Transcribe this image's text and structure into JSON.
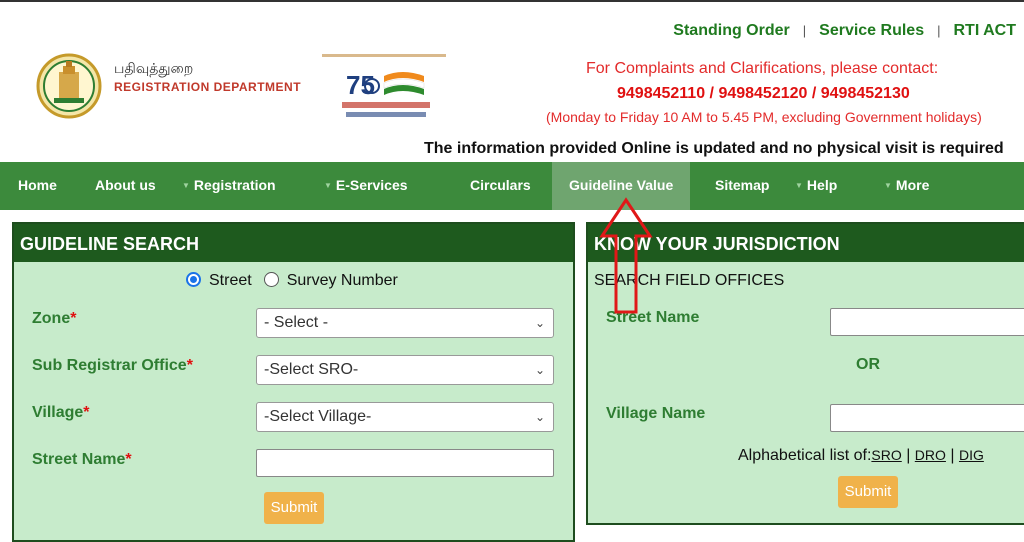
{
  "header": {
    "dept_tamil": "பதிவுத்துறை",
    "dept_english": "REGISTRATION DEPARTMENT",
    "azadi_text": "75",
    "top_links": [
      "Standing Order",
      "Service Rules",
      "RTI ACT"
    ],
    "contact_line1": "For Complaints and Clarifications, please contact:",
    "contact_phones": "9498452110 / 9498452120 / 9498452130",
    "contact_hours": "(Monday to Friday 10 AM to 5.45 PM, excluding Government holidays)",
    "marquee": "The information provided Online is updated and no physical visit is required"
  },
  "nav": {
    "items": [
      {
        "label": "Home"
      },
      {
        "label": "About us"
      },
      {
        "label": "Registration"
      },
      {
        "label": "E-Services"
      },
      {
        "label": "Circulars"
      },
      {
        "label": "Guideline Value"
      },
      {
        "label": "Sitemap"
      },
      {
        "label": "Help"
      },
      {
        "label": "More"
      }
    ]
  },
  "guideline": {
    "title": "GUIDELINE SEARCH",
    "radio_street": "Street",
    "radio_survey": "Survey Number",
    "selected_radio": "Street",
    "zone_label": "Zone",
    "zone_value": "- Select -",
    "sro_label": "Sub Registrar Office",
    "sro_value": "-Select SRO-",
    "village_label": "Village",
    "village_value": "-Select Village-",
    "street_label": "Street Name",
    "street_value": "",
    "required_mark": "*",
    "submit_label": "Submit"
  },
  "jurisdiction": {
    "title": "KNOW YOUR JURISDICTION",
    "subtitle": "SEARCH FIELD OFFICES",
    "street_label": "Street Name",
    "or_label": "OR",
    "village_label": "Village Name",
    "alpha_prefix": "Alphabetical list of:",
    "alpha_links": [
      "SRO",
      "DRO",
      "DIG"
    ],
    "submit_label": "Submit"
  },
  "colors": {
    "nav_green": "#3c8a3c",
    "panel_head": "#1e5a1e",
    "panel_bg": "#c7ebcb",
    "label_green": "#2e7d32",
    "submit_orange": "#f0b24a",
    "contact_red": "#e32b2b"
  }
}
